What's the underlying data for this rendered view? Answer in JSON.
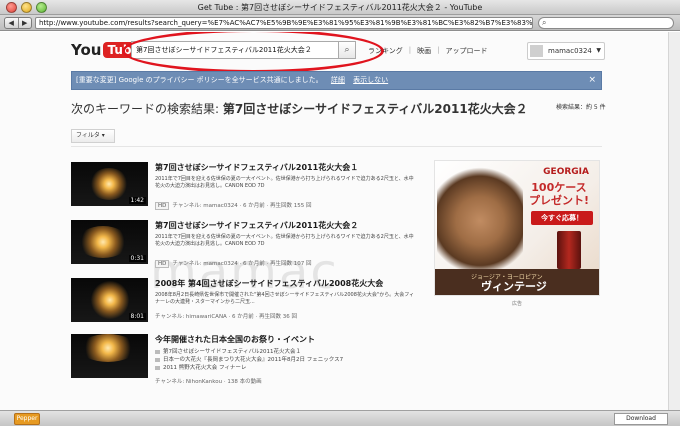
{
  "window": {
    "title": "Get Tube : 第7回させぼシーサイドフェスティバル2011花火大会２ - YouTube"
  },
  "toolbar": {
    "back": "◀",
    "forward": "▶",
    "url": "http://www.youtube.com/results?search_query=%E7%AC%AC7%E5%9B%9E%E3%81%95%E3%81%9B%E3%81%BC%E3%82%B7%E3%83%BC%E3%82%",
    "search_icon": "search-icon",
    "search_glyph": "⌕"
  },
  "header": {
    "logo_you": "You",
    "logo_tube": "Tube",
    "search_value": "第7回させぼシーサイドフェスティバル2011花火大会２",
    "search_button": "⌕",
    "nav": [
      "ランキング",
      "映画",
      "アップロード"
    ],
    "nav_sep": "|",
    "username": "mamac0324",
    "user_chevron": "▼"
  },
  "notice": {
    "text": "[重要な変更] Google のプライバシー ポリシーを全サービス共通にしました。",
    "link_detail": "詳細",
    "link_hide": "表示しない",
    "close": "×"
  },
  "results": {
    "heading_prefix": "次のキーワードの検索結果:",
    "heading_query": "第7回させぼシーサイドフェスティバル2011花火大会２",
    "count": "検索結果：約 5 件",
    "filter": "フィルタ ▾"
  },
  "items": [
    {
      "title": "第7回させぼシーサイドフェスティバル2011花火大会１",
      "desc": "2011年で7回目を迎える佐世保の夏の一大イベント。佐世保港から打ち上げられるワイドで迫力ある2尺玉と、水中花火の大迫力演出はお見逃し。CANON EOD 7D",
      "duration": "1:42",
      "hd": "HD",
      "meta": "チャンネル: mamac0324 · 6 か月前 · 再生回数 155 回"
    },
    {
      "title": "第7回させぼシーサイドフェスティバル2011花火大会２",
      "desc": "2011年で7回目を迎える佐世保の夏の一大イベント。佐世保港から打ち上げられるワイドで迫力ある2尺玉と、水中花火の大迫力演出はお見逃し。CANON EOD 7D",
      "duration": "0:31",
      "hd": "HD",
      "meta": "チャンネル: mamac0324 · 6 か月前 · 再生回数 107 回"
    },
    {
      "title": "2008年 第4回させぼシーサイドフェスティバル2008花火大会",
      "desc": "2008年8月2日長崎県佐世保市で開催された\"第4回させぼシーサイドフェスティバル2008花火大会\"から。大会フィナーレの大連発・スターマインから二尺玉...",
      "duration": "8:01",
      "meta": "チャンネル: himawariCANA · 6 か月前 · 再生回数 36 回"
    }
  ],
  "playlist": {
    "title": "今年開催された日本全国のお祭り・イベント",
    "entries": [
      "第7回させぼシーサイドフェスティバル2011花火大会１",
      "日本一の大花火『長岡まつり大花火大会』2011年8月2日 フェニックス7",
      "2011 熊野大花火大会 フィナーレ"
    ],
    "meta": "チャンネル: NihonKankou · 138 本の動画"
  },
  "ad": {
    "brand": "GEORGIA",
    "promo_line1": "100ケース",
    "promo_line2": "プレゼント!",
    "apply": "今すぐ応募！",
    "sub": "ジョージア・ヨーロピアン",
    "big": "ヴィンテージ",
    "label": "広告"
  },
  "watermark": "mamac",
  "statusbar": {
    "icon": "Pepper",
    "download": "Download"
  }
}
